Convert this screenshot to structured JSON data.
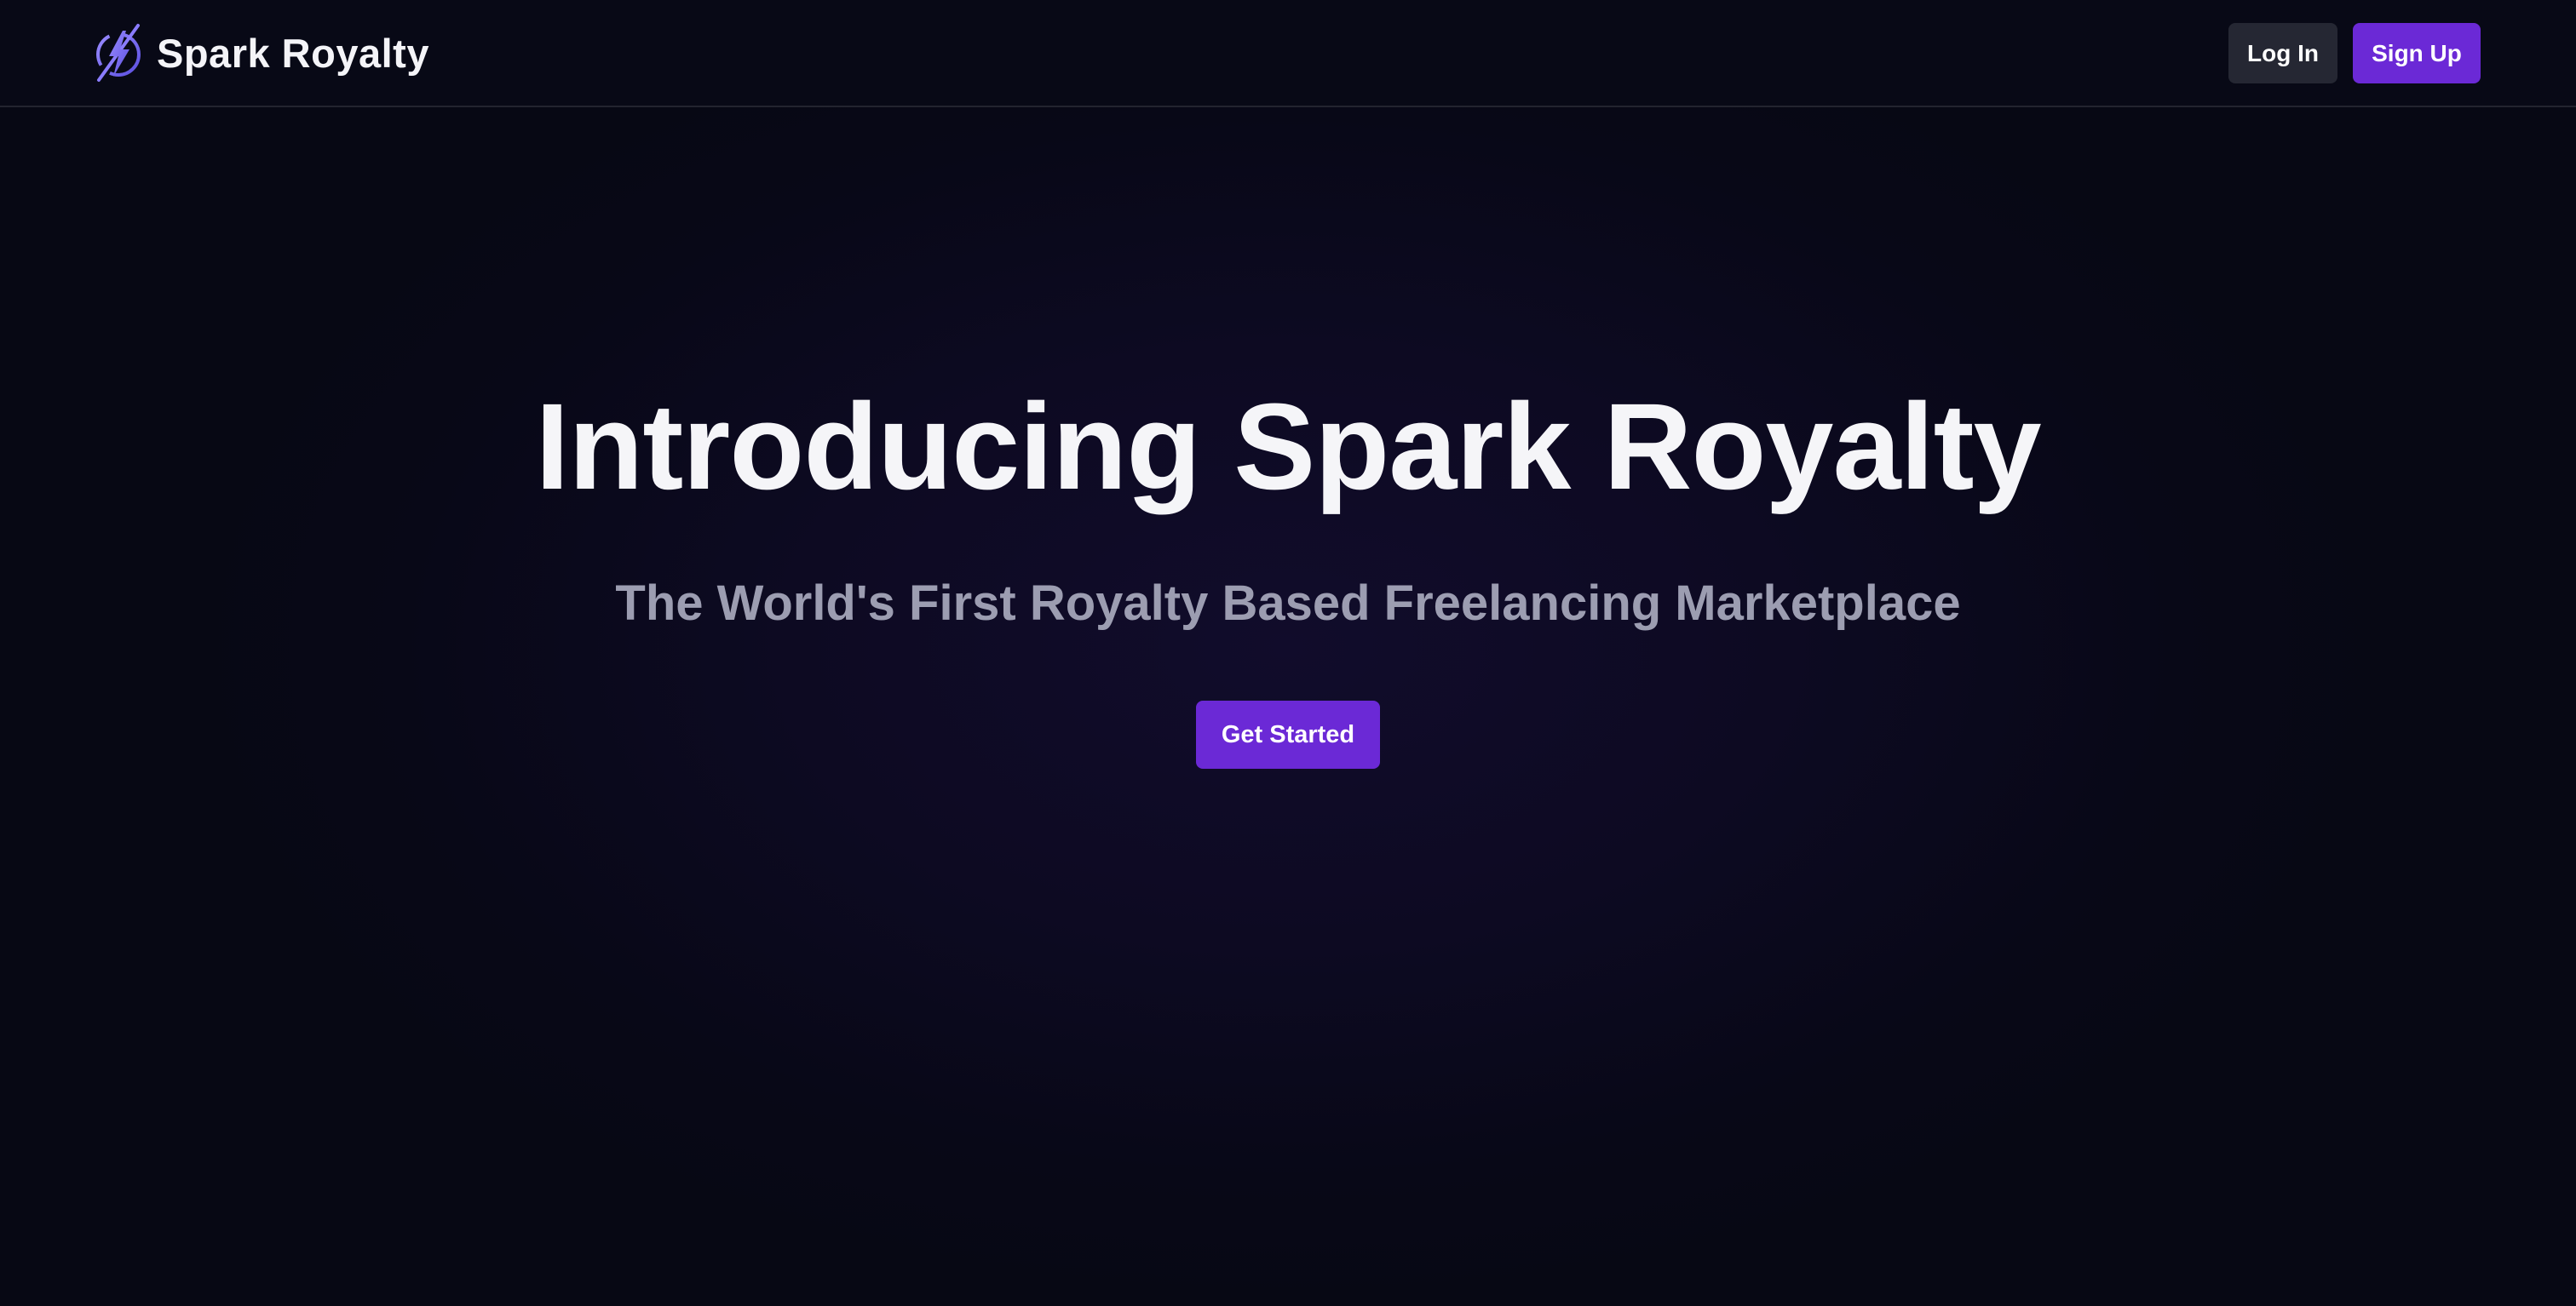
{
  "header": {
    "brand_name": "Spark Royalty",
    "brand_icon": "lightning-bolt-icon",
    "login_label": "Log In",
    "signup_label": "Sign Up"
  },
  "hero": {
    "title": "Introducing Spark Royalty",
    "subtitle": "The World's First Royalty Based Freelancing Marketplace",
    "cta_label": "Get Started"
  },
  "colors": {
    "background": "#070814",
    "accent": "#6b29d6",
    "login_button": "#252733",
    "title_text": "#f5f5f8",
    "subtitle_text": "#9c9db1",
    "icon_accent": "#7b6cf6"
  }
}
